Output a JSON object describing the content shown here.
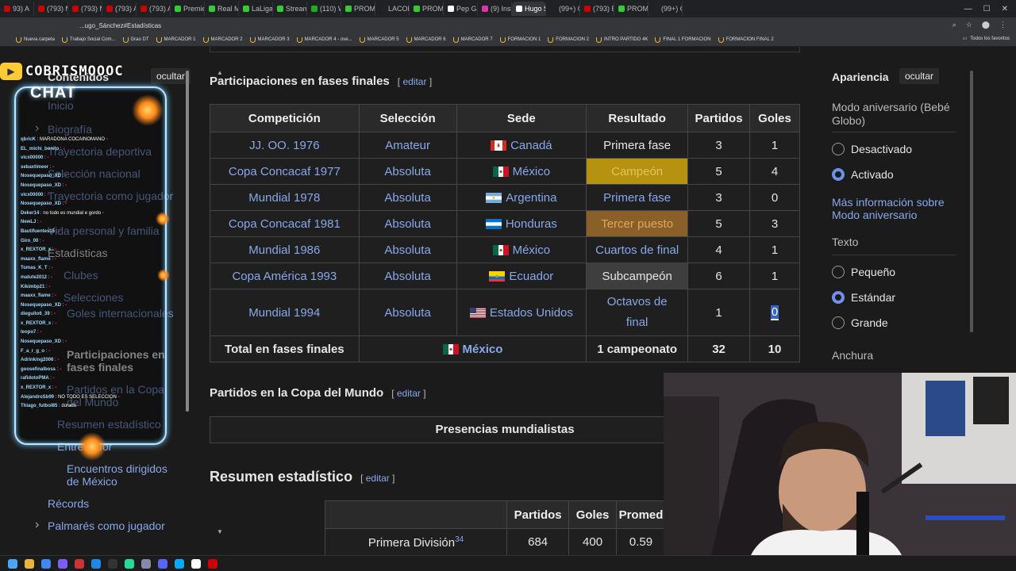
{
  "browser": {
    "tabs": [
      "93) A",
      "(793) M",
      "(793) M",
      "(793) A",
      "(793) A",
      "Premie",
      "Real M",
      "LaLiga",
      "Stream",
      "(110) W",
      "PROMI",
      "LACOB",
      "PROMI",
      "Pep Gu",
      "(9) Insta",
      "Hugo S",
      "(99+) C",
      "(793) E",
      "PROMI",
      "(99+) C"
    ],
    "active_tab_index": 15,
    "url": "...ugo_Sánchez#Estadísticas",
    "bookmarks": [
      "Nueva carpeta",
      "Trabajo Social Com...",
      "Grao DT",
      "MARCADOR 1",
      "MARCADOR 2",
      "MARCADOR 3",
      "MARCADOR 4 - ove...",
      "MARCADOR 5",
      "MARCADOR 6",
      "MARCADOR 7",
      "FORMACION 1",
      "FORMACION 2",
      "INTRO PARTIDO 4K",
      "FINAL 1 FORMACION",
      "FORMACION FINAL 2"
    ],
    "bookmarks_right": "Todos los favoritos"
  },
  "overlay": {
    "logo_text": "COBRISMOOOC",
    "chat_title": "CHAT",
    "chat_messages": [
      {
        "user": "qbricK",
        "text": "MARADONA COCAINOMANO"
      },
      {
        "user": "EL_michi_bonito",
        "text": ""
      },
      {
        "user": "vicx00000",
        "text": ""
      },
      {
        "user": "sebaxtimeer",
        "text": ""
      },
      {
        "user": "Nosequepaso_XD",
        "text": ""
      },
      {
        "user": "Nosequepaso_XD",
        "text": ""
      },
      {
        "user": "vicx00000",
        "text": ""
      },
      {
        "user": "Nosequepaso_XD",
        "text": ""
      },
      {
        "user": "Deker14",
        "text": "no todo es mundial e gordo"
      },
      {
        "user": "NewLJ",
        "text": ""
      },
      {
        "user": "Bautifuentes15",
        "text": ""
      },
      {
        "user": "Giro_00",
        "text": ""
      },
      {
        "user": "x_REXTOR_x",
        "text": ""
      },
      {
        "user": "maaxx_flame",
        "text": ""
      },
      {
        "user": "Tomas_K_T",
        "text": ""
      },
      {
        "user": "matute2012",
        "text": ""
      },
      {
        "user": "Kikimbp21",
        "text": ""
      },
      {
        "user": "maaxx_flame",
        "text": ""
      },
      {
        "user": "Nosequepaso_XD",
        "text": ""
      },
      {
        "user": "dieguito6_39",
        "text": ""
      },
      {
        "user": "x_REXTOR_x",
        "text": ""
      },
      {
        "user": "leopo7",
        "text": ""
      },
      {
        "user": "Nosequepaso_XD",
        "text": ""
      },
      {
        "user": "F_a_r_g_o",
        "text": ""
      },
      {
        "user": "Adrinking2006",
        "text": ""
      },
      {
        "user": "goosefinalboss",
        "text": ""
      },
      {
        "user": "rafidotoPMA",
        "text": ""
      },
      {
        "user": "x_REXTOR_x",
        "text": ""
      },
      {
        "user": "AlejandroSb99",
        "text": "NO TODO ES SELECCION"
      },
      {
        "user": "Thiago_futbol85",
        "text": "dorado"
      }
    ]
  },
  "toc": {
    "heading": "Contenidos",
    "hide_label": "ocultar",
    "items": [
      "Inicio",
      "Biografía",
      "Trayectoria deportiva",
      "Selección nacional",
      "Trayectoria como jugador",
      "Vida personal y familia",
      "Estadísticas",
      "Clubes",
      "Selecciones",
      "Goles internacionales",
      "Participaciones en fases finales",
      "Partidos en la Copa del Mundo",
      "Resumen estadístico",
      "Entrenador",
      "Encuentros dirigidos de México",
      "Récords",
      "Palmarés como jugador"
    ]
  },
  "section1": {
    "title": "Participaciones en fases finales",
    "edit": "editar",
    "headers": [
      "Competición",
      "Selección",
      "Sede",
      "Resultado",
      "Partidos",
      "Goles"
    ],
    "rows": [
      {
        "comp": "JJ. OO. 1976",
        "sel": "Amateur",
        "sede": "Canadá",
        "flag": "ca",
        "res": "Primera fase",
        "res_style": "plain",
        "pj": "3",
        "g": "1"
      },
      {
        "comp": "Copa Concacaf 1977",
        "sel": "Absoluta",
        "sede": "México",
        "flag": "mx",
        "res": "Campeón",
        "res_style": "gold",
        "pj": "5",
        "g": "4"
      },
      {
        "comp": "Mundial 1978",
        "sel": "Absoluta",
        "sede": "Argentina",
        "flag": "ar",
        "res": "Primera fase",
        "res_style": "link",
        "pj": "3",
        "g": "0"
      },
      {
        "comp": "Copa Concacaf 1981",
        "sel": "Absoluta",
        "sede": "Honduras",
        "flag": "hn",
        "res": "Tercer puesto",
        "res_style": "bronze",
        "pj": "5",
        "g": "3"
      },
      {
        "comp": "Mundial 1986",
        "sel": "Absoluta",
        "sede": "México",
        "flag": "mx",
        "res": "Cuartos de final",
        "res_style": "link",
        "pj": "4",
        "g": "1"
      },
      {
        "comp": "Copa América 1993",
        "sel": "Absoluta",
        "sede": "Ecuador",
        "flag": "ec",
        "res": "Subcampeón",
        "res_style": "silver",
        "pj": "6",
        "g": "1"
      },
      {
        "comp": "Mundial 1994",
        "sel": "Absoluta",
        "sede": "Estados Unidos",
        "flag": "us",
        "res": "Octavos de final",
        "res_style": "link",
        "pj": "1",
        "g": "0"
      }
    ],
    "total": {
      "label": "Total en fases finales",
      "sel": "México",
      "res": "1 campeonato",
      "pj": "32",
      "g": "10"
    }
  },
  "section2": {
    "title": "Partidos en la Copa del Mundo",
    "edit": "editar",
    "box": "Presencias mundialistas"
  },
  "section3": {
    "title": "Resumen estadístico",
    "edit": "editar",
    "headers": [
      "Partidos",
      "Goles",
      "Promed"
    ],
    "row": {
      "label": "Primera División",
      "sup": "34",
      "pj": "684",
      "g": "400",
      "prom": "0.59"
    }
  },
  "appearance": {
    "heading": "Apariencia",
    "hide_label": "ocultar",
    "anniv_label": "Modo aniversario (Bebé Globo)",
    "anniv_options": [
      "Desactivado",
      "Activado"
    ],
    "anniv_selected": "Activado",
    "more_info": "Más información sobre Modo aniversario",
    "text_label": "Texto",
    "text_options": [
      "Pequeño",
      "Estándar",
      "Grande"
    ],
    "text_selected": "Estándar",
    "width_label": "Anchura"
  },
  "colors": {
    "link": "#88a8ea",
    "gold": "#b59210",
    "bronze": "#8a5f28",
    "silver": "#3e3e3e",
    "accent": "#6d91e6"
  }
}
